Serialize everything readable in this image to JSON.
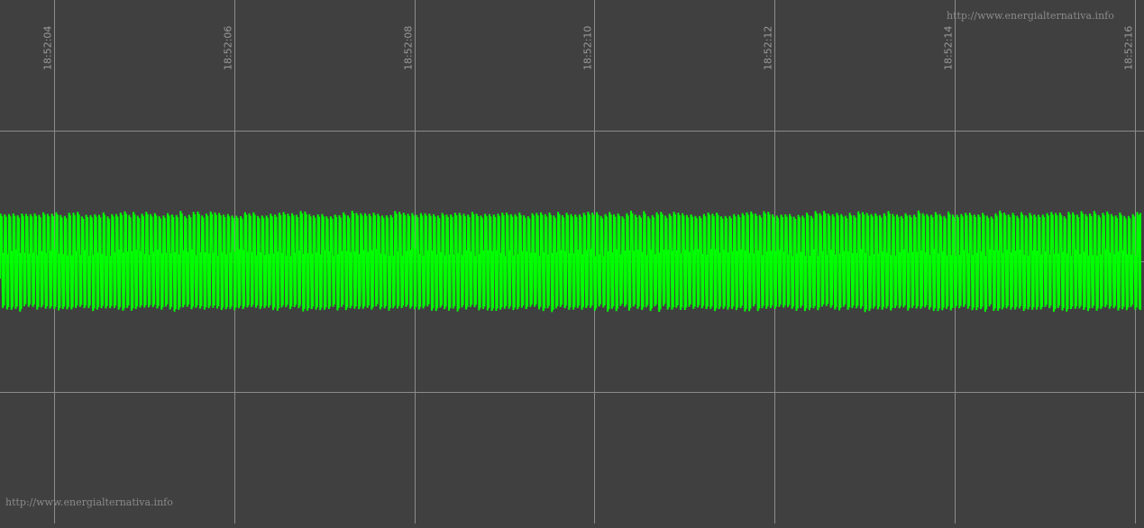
{
  "watermark": {
    "top": "http://www.energialternativa.info",
    "bottom": "http://www.energialternativa.info"
  },
  "colors": {
    "background": "#404040",
    "grid": "#8c8c8c",
    "signal": "#00ff00"
  },
  "chart_data": {
    "type": "line",
    "title": "",
    "xlabel": "",
    "ylabel": "",
    "grid": true,
    "x_tick_labels": [
      "18:52:04",
      "18:52:06",
      "18:52:08",
      "18:52:10",
      "18:52:12",
      "18:52:14",
      "18:52:16"
    ],
    "xlim": [
      "18:52:03.4",
      "18:52:16.1"
    ],
    "ylim": [
      -1,
      1
    ],
    "y_gridlines": [
      -0.5,
      0,
      0.5
    ],
    "series": [
      {
        "color": "#00ff00",
        "signal": "oscillation",
        "amplitude": 0.19,
        "cycles_per_second": 21
      }
    ]
  }
}
